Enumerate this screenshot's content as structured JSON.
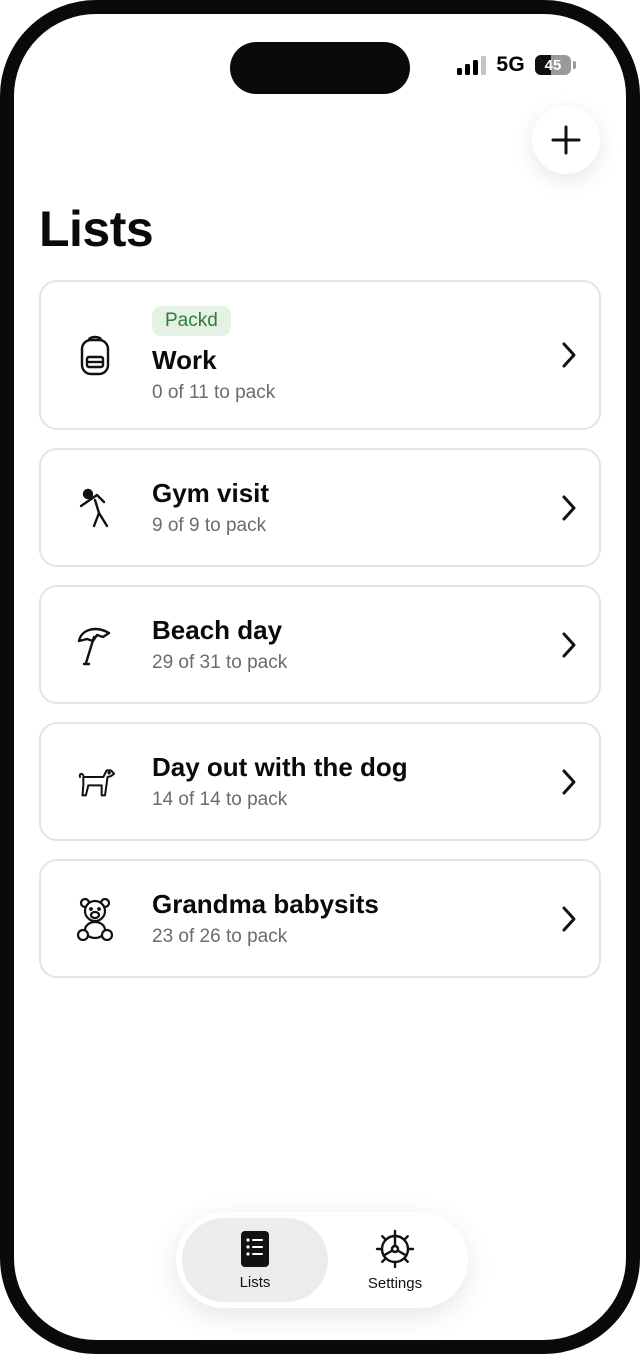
{
  "status_bar": {
    "network": "5G",
    "battery": "45",
    "battery_level": 0.45,
    "signal_bars": 3,
    "signal_max": 4
  },
  "header": {
    "title": "Lists",
    "add_icon": "plus-icon"
  },
  "lists": [
    {
      "badge": "Packd",
      "title": "Work",
      "subtitle": "0 of 11 to pack",
      "icon": "backpack-icon"
    },
    {
      "title": "Gym visit",
      "subtitle": "9 of 9 to pack",
      "icon": "stretching-person-icon"
    },
    {
      "title": "Beach day",
      "subtitle": "29 of 31 to pack",
      "icon": "beach-umbrella-icon"
    },
    {
      "title": "Day out with the dog",
      "subtitle": "14 of 14 to pack",
      "icon": "dog-icon"
    },
    {
      "title": "Grandma babysits",
      "subtitle": "23 of 26 to pack",
      "icon": "teddy-bear-icon"
    }
  ],
  "tabbar": {
    "tabs": [
      {
        "label": "Lists",
        "icon": "list-book-icon",
        "active": true
      },
      {
        "label": "Settings",
        "icon": "gear-icon",
        "active": false
      }
    ]
  }
}
